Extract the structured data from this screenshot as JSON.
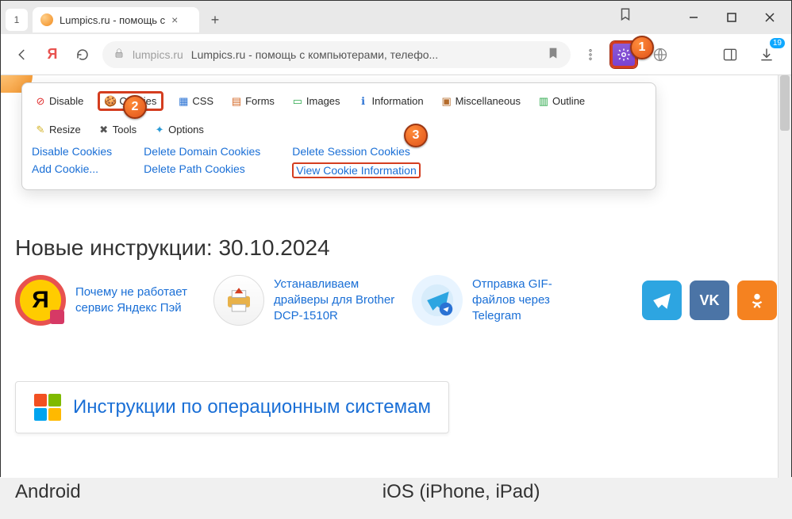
{
  "tab": {
    "index_label": "1",
    "title": "Lumpics.ru - помощь с"
  },
  "window": {
    "minimize": "–",
    "maximize": "□",
    "close": "×"
  },
  "address": {
    "domain": "lumpics.ru",
    "page_title": "Lumpics.ru - помощь с компьютерами, телефо..."
  },
  "ext_badge": "19",
  "annotations": {
    "one": "1",
    "two": "2",
    "three": "3"
  },
  "devtabs": {
    "disable": "Disable",
    "cookies": "Cookies",
    "css": "CSS",
    "forms": "Forms",
    "images": "Images",
    "information": "Information",
    "miscellaneous": "Miscellaneous",
    "outline": "Outline",
    "resize": "Resize",
    "tools": "Tools",
    "options": "Options"
  },
  "devlinks": {
    "col1": {
      "a": "Disable Cookies",
      "b": "Add Cookie..."
    },
    "col2": {
      "a": "Delete Domain Cookies",
      "b": "Delete Path Cookies"
    },
    "col3": {
      "a": "Delete Session Cookies",
      "b": "View Cookie Information"
    }
  },
  "section_heading": "Новые инструкции: 30.10.2024",
  "articles": {
    "a1": "Почему не работает сервис Яндекс Пэй",
    "a2": "Устанавливаем драйверы для Brother DCP-1510R",
    "a3": "Отправка GIF-файлов через Telegram"
  },
  "socials": {
    "tg": "Telegram",
    "vk": "VK",
    "ok": "OK"
  },
  "os_heading": "Инструкции по операционным системам",
  "platforms": {
    "android": "Android",
    "ios": "iOS (iPhone, iPad)"
  },
  "icons": {
    "y": "Я",
    "vk_label": "VK"
  }
}
